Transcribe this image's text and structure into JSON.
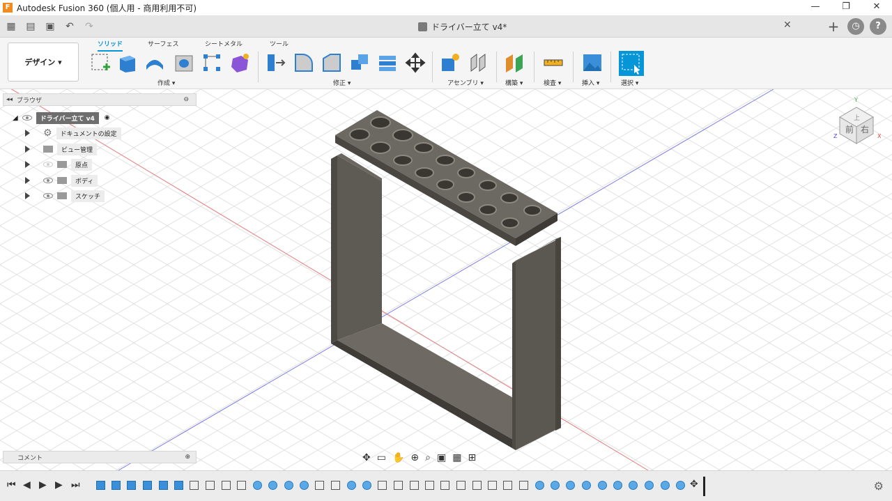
{
  "window": {
    "title": "Autodesk Fusion 360 (個人用 - 商用利用不可)",
    "logo_letter": "F",
    "minimize": "—",
    "restore": "❐",
    "close": "✕"
  },
  "document_tab": {
    "name": "ドライバー立て v4*",
    "close": "✕"
  },
  "qat_right": {
    "new_tab": "+",
    "history": "◷",
    "help": "?"
  },
  "workspace": {
    "label": "デザイン ▾"
  },
  "ribbon_tabs": [
    "ソリッド",
    "サーフェス",
    "シートメタル",
    "ツール"
  ],
  "ribbon_groups": [
    "作成 ▾",
    "修正 ▾",
    "アセンブリ ▾",
    "構築 ▾",
    "検査 ▾",
    "挿入 ▾",
    "選択 ▾"
  ],
  "browser": {
    "header": "ブラウザ",
    "root": "ドライバー立て v4",
    "items": [
      {
        "label": "ドキュメントの設定"
      },
      {
        "label": "ビュー管理"
      },
      {
        "label": "原点"
      },
      {
        "label": "ボディ"
      },
      {
        "label": "スケッチ"
      }
    ]
  },
  "comments": {
    "label": "コメント"
  },
  "viewcube": {
    "front": "前",
    "right": "右",
    "top": "上",
    "axis_x": "X",
    "axis_y": "Y",
    "axis_z": "Z"
  },
  "colors": {
    "accent": "#0696d7",
    "model": "#5e5a54",
    "grid": "#e4e4e4"
  }
}
